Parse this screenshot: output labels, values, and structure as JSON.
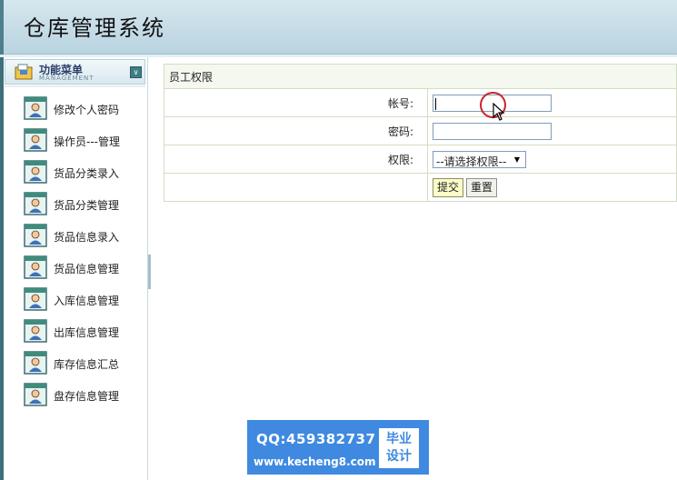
{
  "header": {
    "title": "仓库管理系统"
  },
  "sidebar": {
    "title": "功能菜单",
    "subtitle": "MANAGEMENT",
    "collapse_icon": "double-chevron-down-icon",
    "items": [
      {
        "label": "修改个人密码",
        "icon": "user-card-icon"
      },
      {
        "label": "操作员---管理",
        "icon": "user-card-icon"
      },
      {
        "label": "货品分类录入",
        "icon": "user-card-icon"
      },
      {
        "label": "货品分类管理",
        "icon": "user-card-icon"
      },
      {
        "label": "货品信息录入",
        "icon": "user-card-icon"
      },
      {
        "label": "货品信息管理",
        "icon": "user-card-icon"
      },
      {
        "label": "入库信息管理",
        "icon": "user-card-icon"
      },
      {
        "label": "出库信息管理",
        "icon": "user-card-icon"
      },
      {
        "label": "库存信息汇总",
        "icon": "user-card-icon"
      },
      {
        "label": "盘存信息管理",
        "icon": "user-card-icon"
      }
    ]
  },
  "form": {
    "title": "员工权限",
    "account": {
      "label": "帐号:",
      "value": ""
    },
    "password": {
      "label": "密码:",
      "value": ""
    },
    "role": {
      "label": "权限:",
      "selected": "--请选择权限--"
    },
    "submit_label": "提交",
    "reset_label": "重置"
  },
  "watermark": {
    "qq": "QQ:459382737",
    "url": "www.kecheng8.com",
    "badge_line1": "毕业",
    "badge_line2": "设计"
  },
  "colors": {
    "header_bg": "#c4dbe6",
    "sidebar_edge": "#3e6f7a",
    "form_border": "#d5dcc3",
    "submit_bg": "#fcfcc8",
    "cursor_ring": "#c9242a",
    "watermark_bg": "#3f8ae0"
  }
}
